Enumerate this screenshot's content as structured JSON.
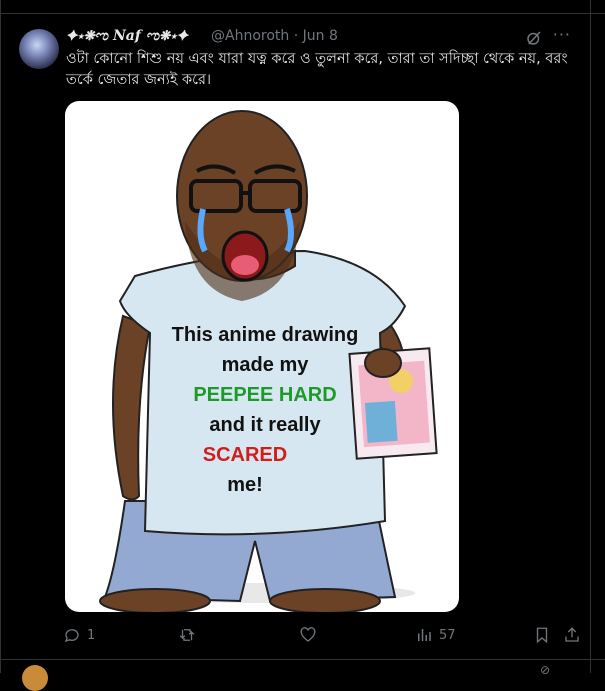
{
  "tweet": {
    "display_name": "✦⋆❋ಌ 𝑵𝒂𝒇 ಌ❋⋆✦",
    "handle": "@Ahnoroth",
    "separator": "·",
    "date": "Jun 8",
    "text": "ওটা কোনো শিশু নয় এবং যারা যত্ন করে ও তুলনা করে, তারা তা সদিচ্ছা থেকে নয়, বরং তর্কে জেতার জন্যই করে।",
    "more_icon": "more-icon",
    "grok_icon": "grok-icon"
  },
  "image": {
    "shirt_lines": [
      "This anime drawing",
      "made my",
      "PEEPEE HARD",
      "and it really",
      "SCARED",
      "me!"
    ],
    "colors": {
      "green": "#1e9a2a",
      "red": "#d21d1d",
      "black": "#111111"
    }
  },
  "actions": {
    "reply_count": "1",
    "retweet_count": "",
    "like_count": "",
    "views_count": "57"
  },
  "colors": {
    "background": "#000000",
    "text": "#e7e9ea",
    "muted": "#71767b",
    "border": "#2f3336"
  }
}
